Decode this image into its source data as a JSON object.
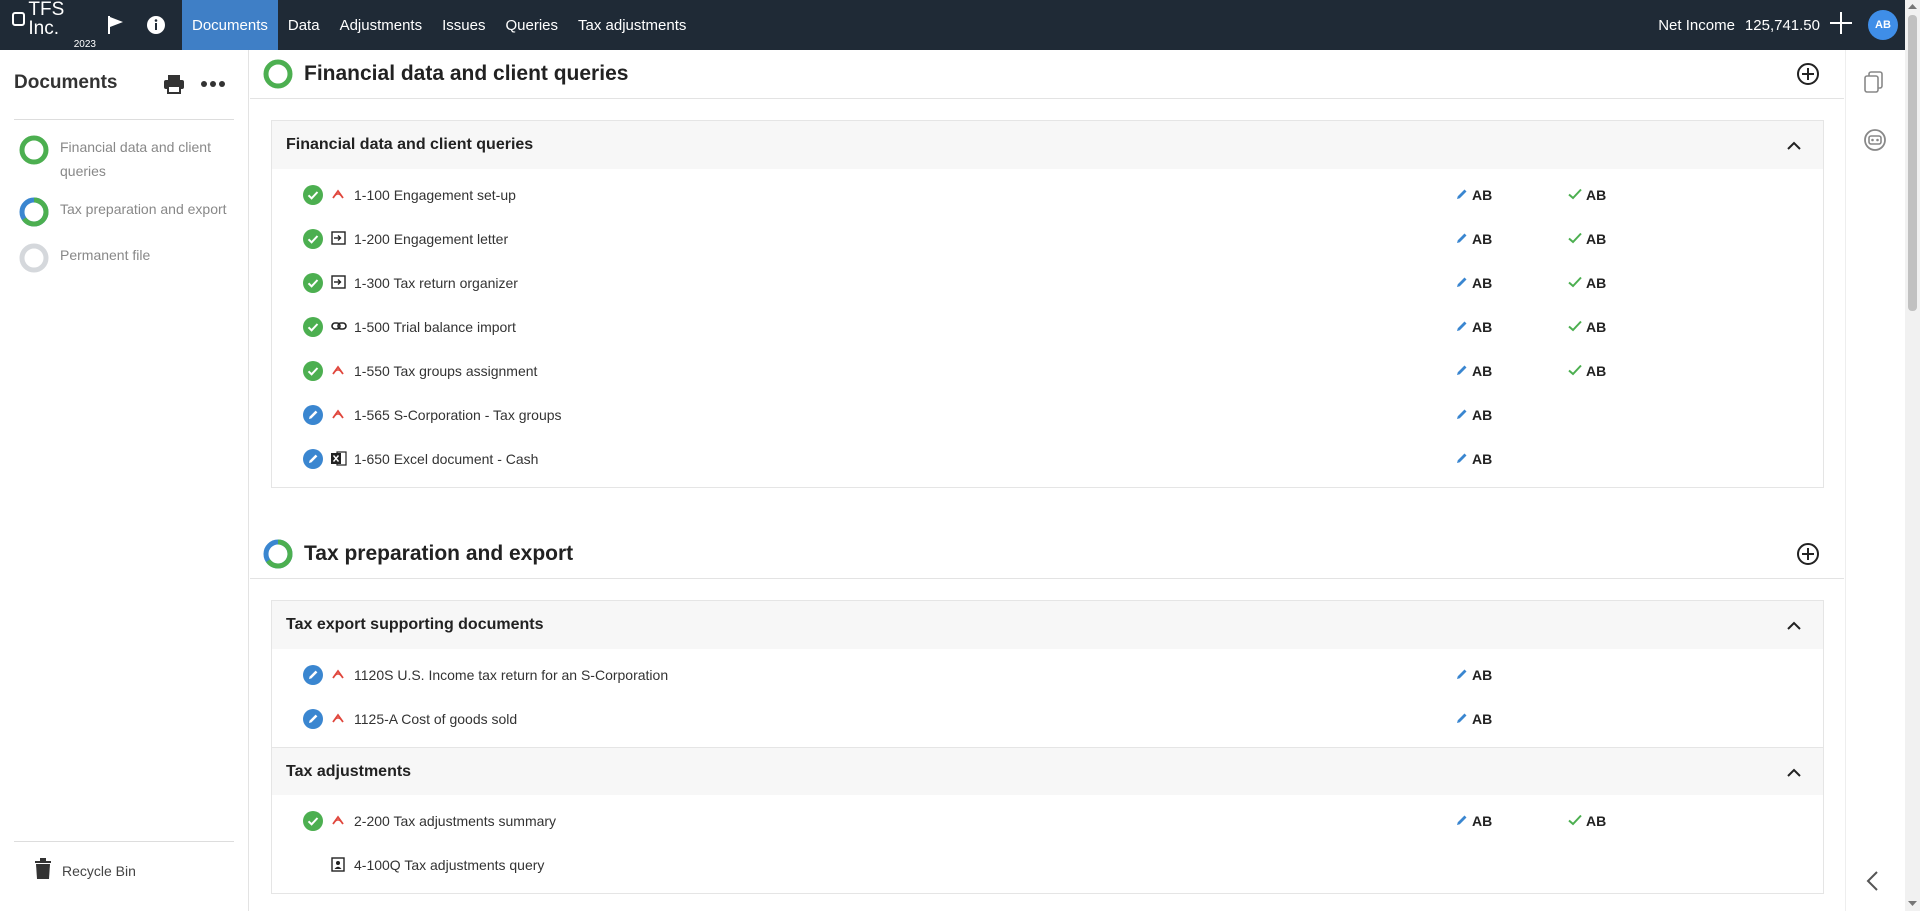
{
  "app": {
    "company": "TFS Inc.",
    "year": "2023"
  },
  "nav": [
    "Documents",
    "Data",
    "Adjustments",
    "Issues",
    "Queries",
    "Tax adjustments"
  ],
  "net_income": {
    "label": "Net Income",
    "value": "125,741.50"
  },
  "user_initials": "AB",
  "sidebar": {
    "title": "Documents",
    "items": [
      {
        "label": "Financial data and client queries",
        "progress": 1.0
      },
      {
        "label": "Tax preparation and export",
        "progress": 0.65
      },
      {
        "label": "Permanent file",
        "progress": 0.0
      }
    ],
    "recycle_label": "Recycle Bin"
  },
  "sections": [
    {
      "title": "Financial data and client queries",
      "progress": 1.0,
      "groups": [
        {
          "title": "Financial data and client queries",
          "rows": [
            {
              "status": "complete",
              "type": "form",
              "name": "1-100 Engagement set-up",
              "preparer": "AB",
              "reviewer": "AB"
            },
            {
              "status": "complete",
              "type": "import",
              "name": "1-200 Engagement letter",
              "preparer": "AB",
              "reviewer": "AB"
            },
            {
              "status": "complete",
              "type": "import",
              "name": "1-300 Tax return organizer",
              "preparer": "AB",
              "reviewer": "AB"
            },
            {
              "status": "complete",
              "type": "link",
              "name": "1-500 Trial balance import",
              "preparer": "AB",
              "reviewer": "AB"
            },
            {
              "status": "complete",
              "type": "form",
              "name": "1-550 Tax groups assignment",
              "preparer": "AB",
              "reviewer": "AB"
            },
            {
              "status": "in-progress",
              "type": "form",
              "name": "1-565 S-Corporation - Tax groups",
              "preparer": "AB",
              "reviewer": ""
            },
            {
              "status": "in-progress",
              "type": "excel",
              "name": "1-650 Excel document - Cash",
              "preparer": "AB",
              "reviewer": ""
            }
          ]
        }
      ]
    },
    {
      "title": "Tax preparation and export",
      "progress": 0.65,
      "groups": [
        {
          "title": "Tax export supporting documents",
          "rows": [
            {
              "status": "in-progress",
              "type": "form",
              "name": "1120S U.S. Income tax return for an S-Corporation",
              "preparer": "AB",
              "reviewer": ""
            },
            {
              "status": "in-progress",
              "type": "form",
              "name": "1125-A Cost of goods sold",
              "preparer": "AB",
              "reviewer": ""
            }
          ]
        },
        {
          "title": "Tax adjustments",
          "rows": [
            {
              "status": "complete",
              "type": "form",
              "name": "2-200 Tax adjustments summary",
              "preparer": "AB",
              "reviewer": "AB"
            },
            {
              "status": "none",
              "type": "query",
              "name": "4-100Q Tax adjustments query",
              "preparer": "",
              "reviewer": ""
            }
          ]
        }
      ]
    }
  ],
  "colors": {
    "topbar": "#1f2a36",
    "accent": "#3f7fc6",
    "complete": "#4caf50",
    "in_progress": "#3a86d0",
    "form_icon": "#e0463c"
  },
  "icons": [
    "flag-icon",
    "info-icon",
    "plus-icon",
    "print-icon",
    "more-icon",
    "trash-icon",
    "add-circle-icon",
    "chevron-up-icon",
    "check-circle-icon",
    "pencil-circle-icon",
    "pencil-icon",
    "check-icon",
    "form-icon",
    "import-icon",
    "link-icon",
    "excel-icon",
    "query-icon",
    "copy-icon",
    "assistant-icon",
    "collapse-icon"
  ]
}
